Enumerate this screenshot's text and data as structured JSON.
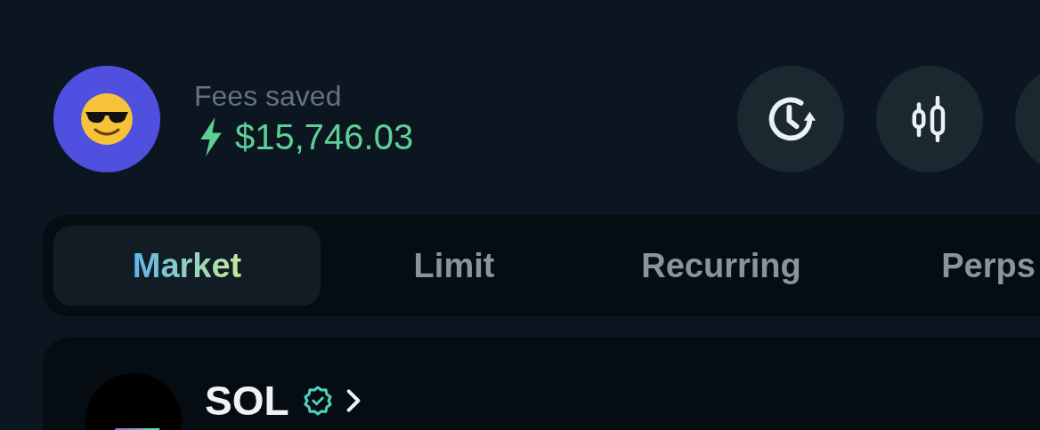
{
  "header": {
    "label": "Fees saved",
    "amount": "$15,746.03"
  },
  "tabs": [
    {
      "label": "Market",
      "selected": true
    },
    {
      "label": "Limit",
      "selected": false
    },
    {
      "label": "Recurring",
      "selected": false
    },
    {
      "label": "Perps",
      "selected": false
    }
  ],
  "token": {
    "symbol": "SOL"
  }
}
